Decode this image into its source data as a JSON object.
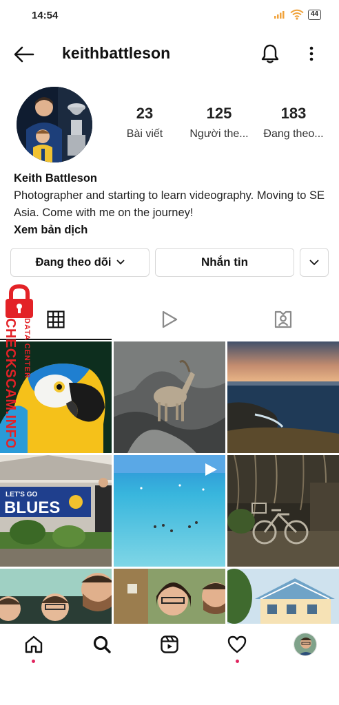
{
  "status_bar": {
    "time": "14:54",
    "battery": "44",
    "icons": [
      "signal-icon",
      "wifi-icon",
      "battery-icon"
    ]
  },
  "header": {
    "username": "keithbattleson",
    "icons": [
      "back-arrow-icon",
      "bell-icon",
      "more-vertical-icon"
    ]
  },
  "stats": [
    {
      "value": "23",
      "label": "Bài viết"
    },
    {
      "value": "125",
      "label": "Người the..."
    },
    {
      "value": "183",
      "label": "Đang theo..."
    }
  ],
  "bio": {
    "name": "Keith Battleson",
    "text": "Photographer and starting to learn videography. Moving to SE Asia. Come with me on the journey!",
    "translate_link": "Xem bản dịch"
  },
  "actions": {
    "following_label": "Đang theo dõi",
    "message_label": "Nhắn tin"
  },
  "watermark": {
    "line1": "DATA CENTER",
    "line2": "CHECKSCAM.INFO"
  },
  "tabs": [
    {
      "icon": "grid-icon",
      "selected": true
    },
    {
      "icon": "reels-play-icon",
      "selected": false
    },
    {
      "icon": "tagged-person-icon",
      "selected": false
    }
  ],
  "grid_posts": [
    {
      "subject": "parrot",
      "type": "photo"
    },
    {
      "subject": "ibex-on-rock",
      "type": "photo"
    },
    {
      "subject": "sunset-sea",
      "type": "photo"
    },
    {
      "subject": "lets-go-blues-banner",
      "type": "photo"
    },
    {
      "subject": "turquoise-sea",
      "type": "video"
    },
    {
      "subject": "bicycle-under-tree",
      "type": "photo"
    },
    {
      "subject": "family-selfie",
      "type": "photo"
    },
    {
      "subject": "couple-selfie",
      "type": "photo"
    },
    {
      "subject": "blue-house",
      "type": "photo"
    }
  ],
  "grid_text": {
    "banner_small": "LET'S GO",
    "banner_big": "BLUES"
  },
  "bottom_nav": [
    {
      "icon": "home-icon",
      "dot": true
    },
    {
      "icon": "search-icon",
      "dot": false
    },
    {
      "icon": "reels-icon",
      "dot": false
    },
    {
      "icon": "heart-icon",
      "dot": true
    },
    {
      "icon": "profile-avatar",
      "dot": false
    }
  ],
  "colors": {
    "accent_dot": "#e0245e",
    "watermark_red": "#e32227",
    "border": "#d7d7d7"
  }
}
